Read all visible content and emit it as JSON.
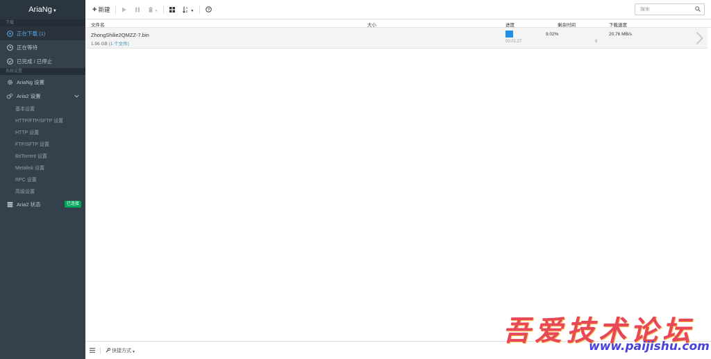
{
  "app": {
    "brand": "AriaNg"
  },
  "sidebar": {
    "section_download": "下载",
    "nav": [
      {
        "label": "正在下载 (1)",
        "icon": "play-circle-icon"
      },
      {
        "label": "正在等待",
        "icon": "clock-icon"
      },
      {
        "label": "已完成 / 已停止",
        "icon": "check-circle-icon"
      }
    ],
    "section_settings": "系统设置",
    "ariang_settings": "AriaNg 设置",
    "aria2_settings": "Aria2 设置",
    "aria2_sub": [
      "基本设置",
      "HTTP/FTP/SFTP 设置",
      "HTTP 设置",
      "FTP/SFTP 设置",
      "BitTorrent 设置",
      "Metalink 设置",
      "RPC 设置",
      "高级设置"
    ],
    "aria2_status": "Aria2 状态",
    "status_badge": "已连接"
  },
  "toolbar": {
    "new_label": "新建",
    "search_placeholder": "搜索"
  },
  "table": {
    "headers": {
      "name": "文件名",
      "size": "大小",
      "progress": "进度",
      "remaining": "剩余时间",
      "speed": "下载速度"
    },
    "rows": [
      {
        "filename": "ZhongShilie2QMZZ-7.bin",
        "size": "1.96 GB",
        "files": "(1 个文件)",
        "progress_pct": "9.02%",
        "progress_fraction": 0.0902,
        "elapsed": "00:01:27",
        "connections": "8",
        "speed": "20.76 MB/s"
      }
    ]
  },
  "footer": {
    "quick_label": "快捷方式"
  },
  "watermark": {
    "title": "吾爱技术论坛",
    "url": "www.paijishu.com"
  },
  "colors": {
    "accent": "#208fe5",
    "sidebar_bg": "#34404b",
    "badge_green": "#00a65a"
  }
}
